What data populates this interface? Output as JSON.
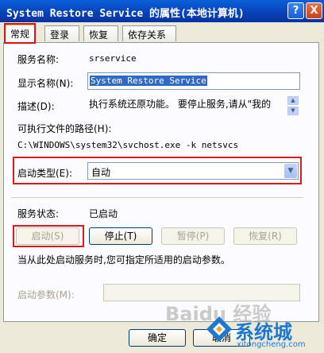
{
  "window": {
    "title": "System Restore Service 的属性(本地计算机)",
    "help_glyph": "?",
    "close_glyph": "X"
  },
  "tabs": [
    {
      "label": "常规"
    },
    {
      "label": "登录"
    },
    {
      "label": "恢复"
    },
    {
      "label": "依存关系"
    }
  ],
  "general": {
    "service_name_label": "服务名称:",
    "service_name_value": "srservice",
    "display_name_label": "显示名称(N):",
    "display_name_value": "System Restore Service",
    "description_label": "描述(D):",
    "description_value": "执行系统还原功能。 要停止服务,请从\"我的",
    "exe_path_label": "可执行文件的路径(H):",
    "exe_path_value": "C:\\WINDOWS\\system32\\svchost.exe -k netsvcs",
    "startup_type_label": "启动类型(E):",
    "startup_type_value": "自动",
    "status_label": "服务状态:",
    "status_value": "已启动",
    "buttons": {
      "start": "启动(S)",
      "stop": "停止(T)",
      "pause": "暂停(P)",
      "resume": "恢复(R)"
    },
    "hint": "当从此处启动服务时,您可指定所适用的启动参数。",
    "start_params_label": "启动参数(M):"
  },
  "footer": {
    "ok": "确定",
    "cancel": "取消"
  },
  "watermark": {
    "text": "Baidu 经验",
    "brand": "系统城",
    "url": "xitongcheng.com"
  },
  "colors": {
    "highlight_box": "#d81b1b",
    "selection": "#316ac5",
    "titlebar": "#0840b8"
  }
}
